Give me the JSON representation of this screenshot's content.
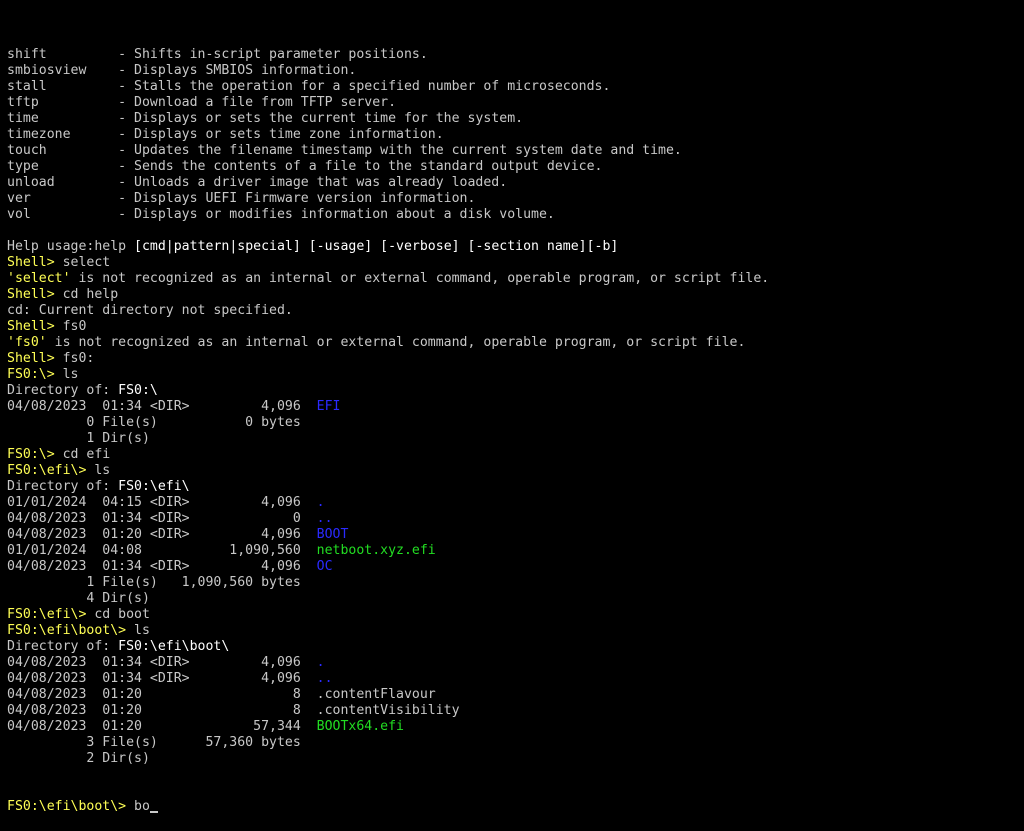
{
  "colors": {
    "background": "#000000",
    "text": "#c8c8c8",
    "prompt": "#ffff55",
    "directory": "#2a2aff",
    "executable": "#22dd22",
    "highlight": "#ffffff"
  },
  "lines": [
    [
      {
        "t": "shift         - Shifts in-script parameter positions."
      }
    ],
    [
      {
        "t": "smbiosview    - Displays SMBIOS information."
      }
    ],
    [
      {
        "t": "stall         - Stalls the operation for a specified number of microseconds."
      }
    ],
    [
      {
        "t": "tftp          - Download a file from TFTP server."
      }
    ],
    [
      {
        "t": "time          - Displays or sets the current time for the system."
      }
    ],
    [
      {
        "t": "timezone      - Displays or sets time zone information."
      }
    ],
    [
      {
        "t": "touch         - Updates the filename timestamp with the current system date and time."
      }
    ],
    [
      {
        "t": "type          - Sends the contents of a file to the standard output device."
      }
    ],
    [
      {
        "t": "unload        - Unloads a driver image that was already loaded."
      }
    ],
    [
      {
        "t": "ver           - Displays UEFI Firmware version information."
      }
    ],
    [
      {
        "t": "vol           - Displays or modifies information about a disk volume."
      }
    ],
    [
      {
        "t": ""
      }
    ],
    [
      {
        "t": "Help usage:help "
      },
      {
        "t": "[cmd|pattern|special] [-usage] [-verbose] [-section name][-b]",
        "c": "hl"
      }
    ],
    [
      {
        "t": "Shell> ",
        "c": "prompt"
      },
      {
        "t": "select"
      }
    ],
    [
      {
        "t": "'select'",
        "c": "prompt"
      },
      {
        "t": " is not recognized as an internal or external command, operable program, or script file."
      }
    ],
    [
      {
        "t": "Shell> ",
        "c": "prompt"
      },
      {
        "t": "cd help"
      }
    ],
    [
      {
        "t": "cd: Current directory not specified."
      }
    ],
    [
      {
        "t": "Shell> ",
        "c": "prompt"
      },
      {
        "t": "fs0"
      }
    ],
    [
      {
        "t": "'fs0'",
        "c": "prompt"
      },
      {
        "t": " is not recognized as an internal or external command, operable program, or script file."
      }
    ],
    [
      {
        "t": "Shell> ",
        "c": "prompt"
      },
      {
        "t": "fs0:"
      }
    ],
    [
      {
        "t": "FS0:\\> ",
        "c": "prompt"
      },
      {
        "t": "ls"
      }
    ],
    [
      {
        "t": "Directory of: "
      },
      {
        "t": "FS0:\\",
        "c": "hl"
      }
    ],
    [
      {
        "t": "04/08/2023  01:34 <DIR>         4,096  "
      },
      {
        "t": "EFI",
        "c": "dir"
      }
    ],
    [
      {
        "t": "          0 File(s)           0 bytes"
      }
    ],
    [
      {
        "t": "          1 Dir(s)"
      }
    ],
    [
      {
        "t": "FS0:\\> ",
        "c": "prompt"
      },
      {
        "t": "cd efi"
      }
    ],
    [
      {
        "t": "FS0:\\efi\\> ",
        "c": "prompt"
      },
      {
        "t": "ls"
      }
    ],
    [
      {
        "t": "Directory of: "
      },
      {
        "t": "FS0:\\efi\\",
        "c": "hl"
      }
    ],
    [
      {
        "t": "01/01/2024  04:15 <DIR>         4,096  "
      },
      {
        "t": ".",
        "c": "dir"
      }
    ],
    [
      {
        "t": "04/08/2023  01:34 <DIR>             0  "
      },
      {
        "t": "..",
        "c": "dir"
      }
    ],
    [
      {
        "t": "04/08/2023  01:20 <DIR>         4,096  "
      },
      {
        "t": "BOOT",
        "c": "dir"
      }
    ],
    [
      {
        "t": "01/01/2024  04:08           1,090,560  "
      },
      {
        "t": "netboot.xyz.efi",
        "c": "exe"
      }
    ],
    [
      {
        "t": "04/08/2023  01:34 <DIR>         4,096  "
      },
      {
        "t": "OC",
        "c": "dir"
      }
    ],
    [
      {
        "t": "          1 File(s)   1,090,560 bytes"
      }
    ],
    [
      {
        "t": "          4 Dir(s)"
      }
    ],
    [
      {
        "t": "FS0:\\efi\\> ",
        "c": "prompt"
      },
      {
        "t": "cd boot"
      }
    ],
    [
      {
        "t": "FS0:\\efi\\boot\\> ",
        "c": "prompt"
      },
      {
        "t": "ls"
      }
    ],
    [
      {
        "t": "Directory of: "
      },
      {
        "t": "FS0:\\efi\\boot\\",
        "c": "hl"
      }
    ],
    [
      {
        "t": "04/08/2023  01:34 <DIR>         4,096  "
      },
      {
        "t": ".",
        "c": "dir"
      }
    ],
    [
      {
        "t": "04/08/2023  01:34 <DIR>         4,096  "
      },
      {
        "t": "..",
        "c": "dir"
      }
    ],
    [
      {
        "t": "04/08/2023  01:20                   8  .contentFlavour"
      }
    ],
    [
      {
        "t": "04/08/2023  01:20                   8  .contentVisibility"
      }
    ],
    [
      {
        "t": "04/08/2023  01:20              57,344  "
      },
      {
        "t": "BOOTx64.efi",
        "c": "exe"
      }
    ],
    [
      {
        "t": "          3 File(s)      57,360 bytes"
      }
    ],
    [
      {
        "t": "          2 Dir(s)"
      }
    ]
  ],
  "input_line": {
    "prompt": "FS0:\\efi\\boot\\> ",
    "typed": "bo"
  }
}
